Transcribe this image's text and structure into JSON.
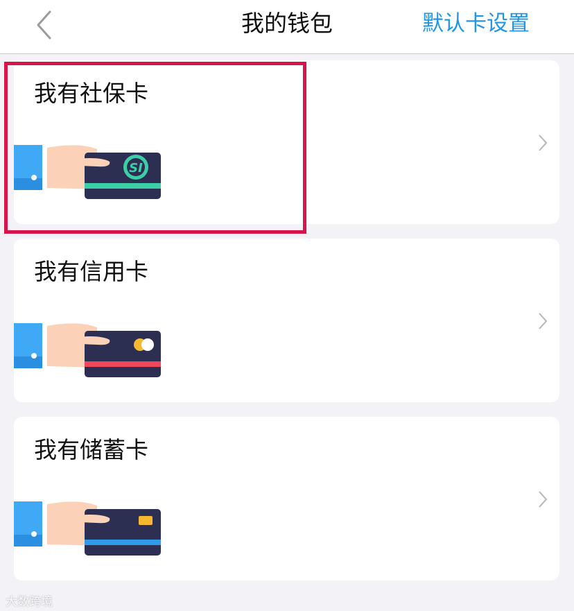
{
  "header": {
    "back_icon": "chevron-left-icon",
    "title": "我的钱包",
    "right_action": "默认卡设置",
    "accent": "#2196e6"
  },
  "cards": [
    {
      "label": "我有社保卡",
      "card_icon": "social-security-card-icon",
      "card_color": "#2c2e52",
      "stripe_color": "#3ccfa6",
      "emblem_text": "SI",
      "highlighted": true
    },
    {
      "label": "我有信用卡",
      "card_icon": "credit-card-icon",
      "card_color": "#2c2e52",
      "stripe_color": "#f0465c"
    },
    {
      "label": "我有储蓄卡",
      "card_icon": "debit-card-icon",
      "card_color": "#2c2e52",
      "stripe_color": "#2f9be8"
    }
  ],
  "highlight_color": "#d8154a",
  "watermark": "大数跨境"
}
